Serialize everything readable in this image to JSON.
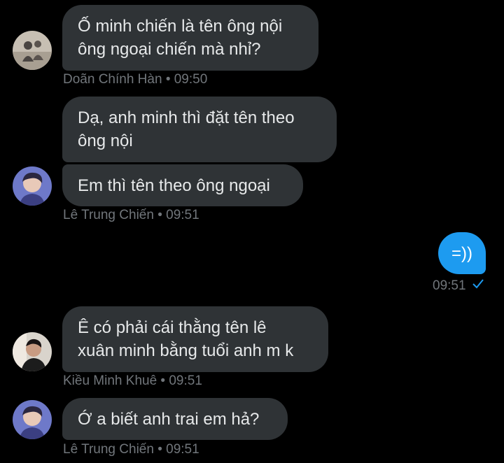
{
  "messages": [
    {
      "text": "Ố minh chiến là tên ông nội\nông ngoại chiến mà nhỉ?"
    },
    {
      "text": "Dạ, anh minh thì đặt tên theo\nông nội"
    },
    {
      "text": "Em thì tên theo ông ngoại"
    },
    {
      "text": "=))"
    },
    {
      "text": "Ê có phải cái thằng tên lê\nxuân minh bằng tuổi anh m k"
    },
    {
      "text": "Ớ a biết anh trai em hả?"
    }
  ],
  "meta": {
    "m1": "Doãn Chính Hàn • 09:50",
    "m2": "Lê Trung Chiến • 09:51",
    "sent": "09:51",
    "m3": "Kiều Minh Khuê • 09:51",
    "m4": "Lê Trung Chiến • 09:51"
  },
  "icons": {
    "sent_status": "check-icon"
  },
  "colors": {
    "background": "#000000",
    "received_bubble": "#2f3336",
    "sent_bubble": "#1d9bf0",
    "meta_text": "#71767b",
    "check": "#1d9bf0"
  }
}
